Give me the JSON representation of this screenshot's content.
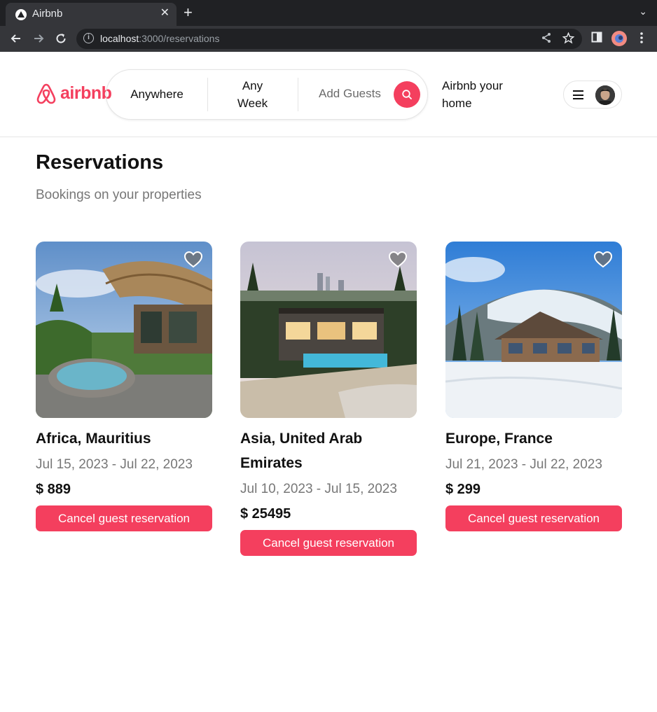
{
  "browser": {
    "tab_title": "Airbnb",
    "tab_close": "✕",
    "new_tab": "+",
    "tab_menu": "⌄",
    "url_host": "localhost",
    "url_rest": ":3000/reservations"
  },
  "navbar": {
    "logo_text": "airbnb",
    "search": {
      "anywhere": "Anywhere",
      "any_week": "Any Week",
      "add_guests": "Add Guests"
    },
    "host_link": "Airbnb your home"
  },
  "page": {
    "title": "Reservations",
    "subtitle": "Bookings on your properties"
  },
  "reservations": [
    {
      "location": "Africa, Mauritius",
      "dates": "Jul 15, 2023 - Jul 22, 2023",
      "price": "$ 889",
      "button": "Cancel guest reservation"
    },
    {
      "location": "Asia, United Arab Emirates",
      "dates": "Jul 10, 2023 - Jul 15, 2023",
      "price": "$ 25495",
      "button": "Cancel guest reservation"
    },
    {
      "location": "Europe, France",
      "dates": "Jul 21, 2023 - Jul 22, 2023",
      "price": "$ 299",
      "button": "Cancel guest reservation"
    }
  ],
  "colors": {
    "brand": "#f43f5e",
    "chrome_dark": "#202124",
    "chrome_mid": "#35363a"
  },
  "icons": [
    "back-arrow-icon",
    "forward-arrow-icon",
    "reload-icon",
    "info-icon",
    "share-icon",
    "star-icon",
    "side-panel-icon",
    "profile-icon",
    "kebab-menu-icon",
    "search-icon",
    "hamburger-icon",
    "heart-icon"
  ]
}
